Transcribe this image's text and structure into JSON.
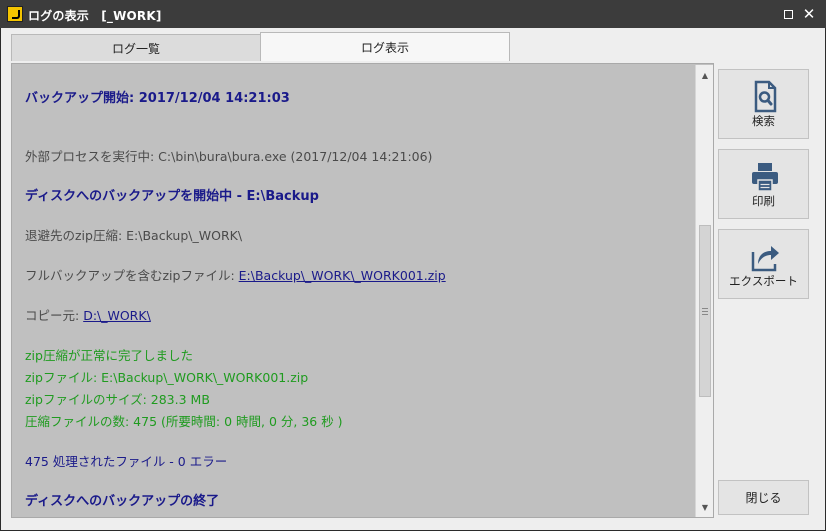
{
  "window": {
    "title": "ログの表示　[_WORK]",
    "maximize_glyph": "□",
    "close_glyph": "✕"
  },
  "tabs": [
    {
      "label": "ログ一覧",
      "active": false
    },
    {
      "label": "ログ表示",
      "active": true
    }
  ],
  "log": {
    "header_start": "バックアップ開始: 2017/12/04 14:21:03",
    "external_process": "外部プロセスを実行中: C:\\bin\\bura\\bura.exe (2017/12/04 14:21:06)",
    "disk_backup_start": "ディスクへのバックアップを開始中 - E:\\Backup",
    "evacuation": "退避先のzip圧縮: E:\\Backup\\_WORK\\",
    "full_zip_prefix": "フルバックアップを含むzipファイル: ",
    "full_zip_link": "E:\\Backup\\_WORK\\_WORK001.zip",
    "copy_source_prefix": "コピー元: ",
    "copy_source_link": "D:\\_WORK\\",
    "zip_ok": "zip圧縮が正常に完了しました",
    "zip_file": "zipファイル: E:\\Backup\\_WORK\\_WORK001.zip",
    "zip_size": "zipファイルのサイズ: 283.3 MB",
    "zip_count": "圧縮ファイルの数: 475 (所要時間: 0 時間, 0 分, 36 秒 )",
    "processed": "475 処理されたファイル - 0 エラー",
    "disk_backup_end": "ディスクへのバックアップの終了"
  },
  "sidebar": {
    "search_label": "検索",
    "print_label": "印刷",
    "export_label": "エクスポート",
    "close_label": "閉じる"
  },
  "colors": {
    "header_text": "#1a1a8a",
    "success_text": "#1f9b1f",
    "normal_text": "#4a4a4a",
    "icon_blue": "#3b5b80"
  }
}
